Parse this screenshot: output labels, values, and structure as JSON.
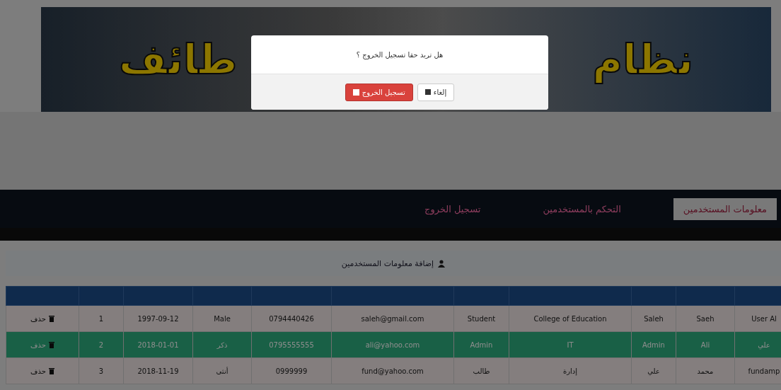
{
  "banner": {
    "title_parts": [
      "نظام",
      "طائف"
    ]
  },
  "nav": {
    "tabs": [
      {
        "label": "معلومات المستخدمين",
        "selected": true
      },
      {
        "label": "التحكم بالمستخدمين",
        "selected": false
      },
      {
        "label": "تسجيل الخروج",
        "selected": false
      }
    ]
  },
  "section": {
    "title": "إضافة معلومات المستخدمين"
  },
  "table": {
    "rows": [
      {
        "selected": false,
        "cells": [
          "User Al",
          "Saeh",
          "Saleh",
          "College of Education",
          "Student",
          "saleh@gmail.com",
          "0794440426",
          "Male",
          "1997-09-12",
          "1"
        ],
        "action": "حذف"
      },
      {
        "selected": true,
        "cells": [
          "علي",
          "Ali",
          "Admin",
          "IT",
          "Admin",
          "ali@yahoo.com",
          "0795555555",
          "ذكر",
          "2018-01-01",
          "2"
        ],
        "action": "حذف"
      },
      {
        "selected": false,
        "cells": [
          "fundamp",
          "محمد",
          "علي",
          "إدارة",
          "طالب",
          "fund@yahoo.com",
          "0999999",
          "أنثى",
          "2018-11-19",
          "3"
        ],
        "action": "حذف"
      }
    ]
  },
  "dialog": {
    "message": "هل تريد حقا تسجيل الخروج ؟",
    "confirm": "تسجيل الخروج",
    "cancel": "إلغاء"
  }
}
